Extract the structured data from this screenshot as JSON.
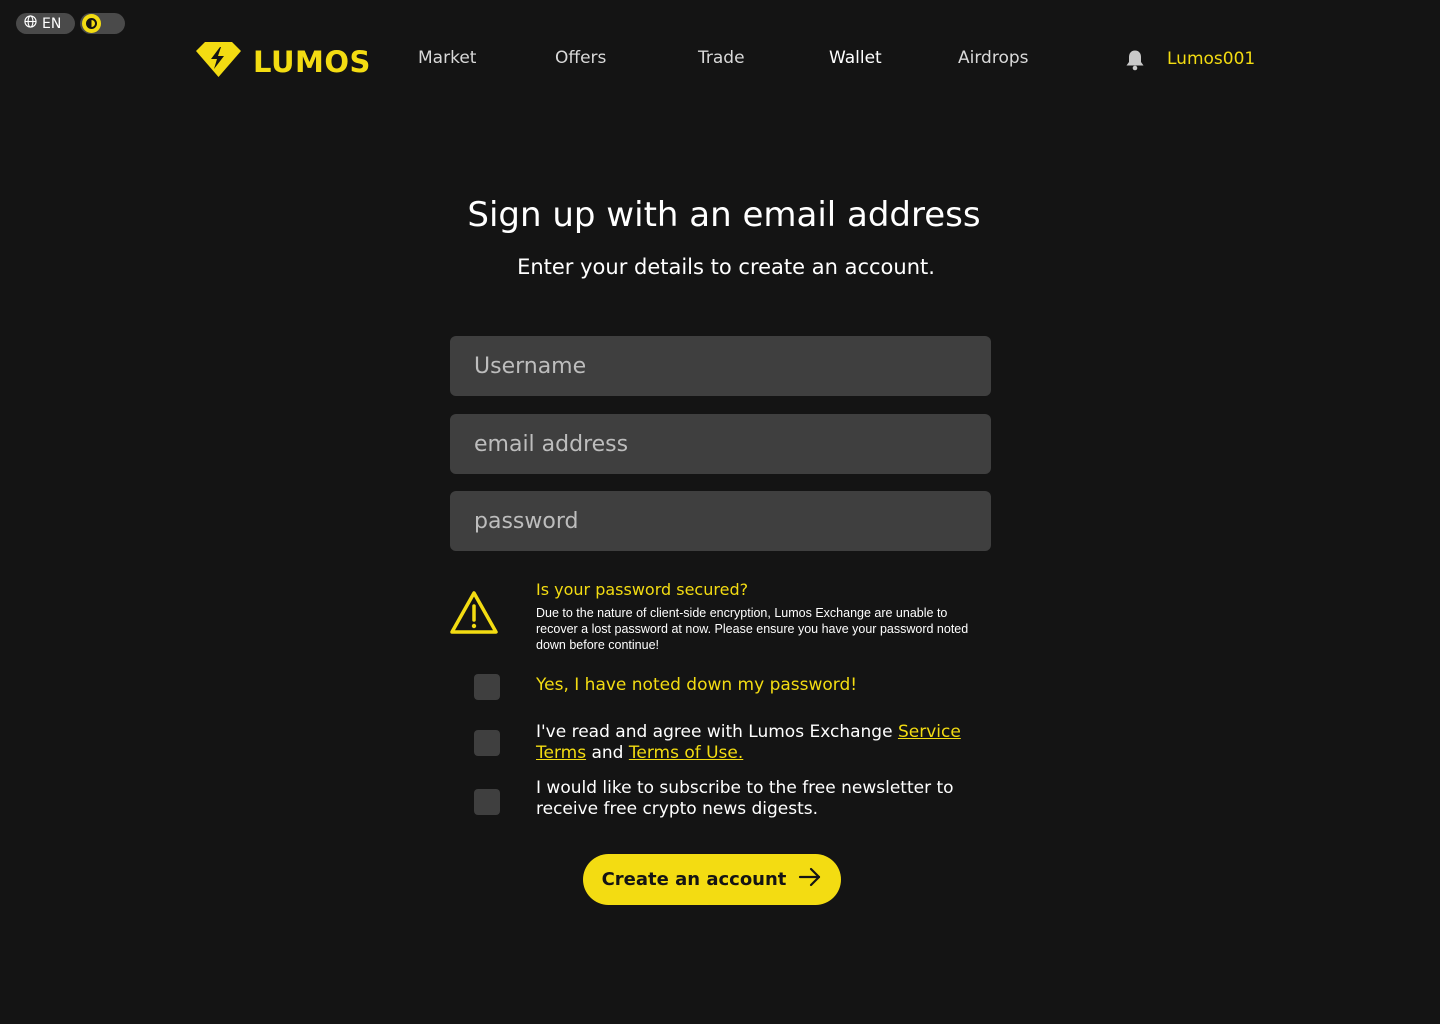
{
  "topbar": {
    "language_label": "EN",
    "language_icon": "globe-icon",
    "theme_icon": "contrast-icon"
  },
  "header": {
    "brand": "LUMOS",
    "nav": [
      {
        "label": "Market"
      },
      {
        "label": "Offers"
      },
      {
        "label": "Trade"
      },
      {
        "label": "Wallet",
        "active": true
      },
      {
        "label": "Airdrops"
      }
    ],
    "notification_icon": "bell-icon",
    "username": "Lumos001"
  },
  "main": {
    "title": "Sign up with an email address",
    "subtitle": "Enter your details to create an account."
  },
  "form": {
    "username_placeholder": "Username",
    "email_placeholder": "email address",
    "password_placeholder": "password"
  },
  "warning": {
    "icon": "warning-icon",
    "title": "Is your password secured?",
    "text": "Due to the nature of client-side encryption, Lumos Exchange are unable to recover a lost password at now. Please ensure you have your password noted down before continue!"
  },
  "checkboxes": {
    "noted_label": "Yes, I have noted down my password!",
    "terms_prefix": "I've read and agree with Lumos Exchange ",
    "terms_link1": "Service Terms",
    "terms_and": " and ",
    "terms_link2": "Terms of Use.",
    "newsletter_label": "I would like to subscribe to the free newsletter to receive free crypto news digests."
  },
  "cta": {
    "label": "Create an account",
    "icon": "arrow-right-icon"
  },
  "colors": {
    "background": "#141414",
    "accent": "#f3dc12",
    "field": "#3f3f3f"
  }
}
